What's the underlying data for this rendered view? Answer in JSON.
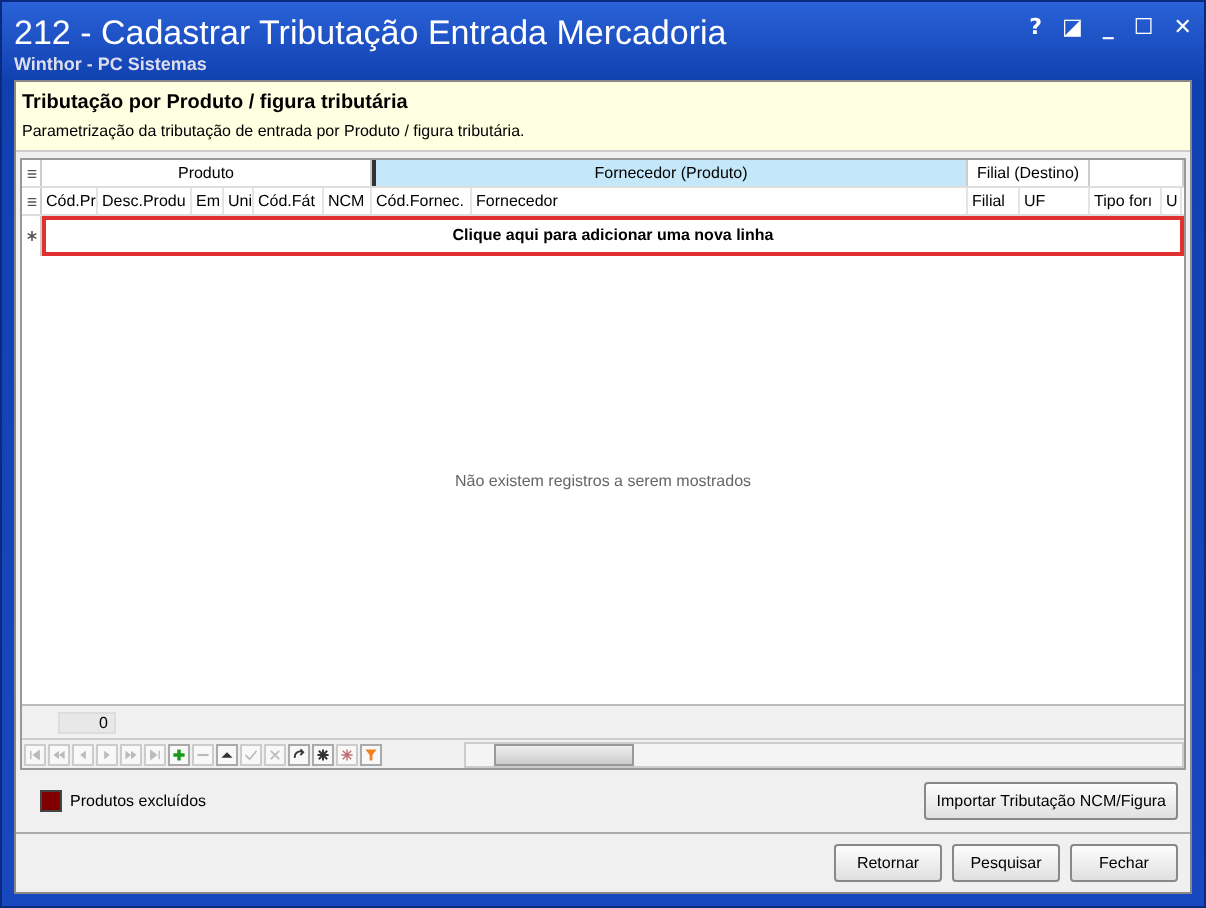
{
  "window": {
    "title": "212 - Cadastrar Tributação Entrada Mercadoria",
    "subtitle": "Winthor - PC Sistemas",
    "controls": [
      "?",
      "◪",
      "_",
      "☐",
      "✕"
    ]
  },
  "header": {
    "title": "Tributação por Produto / figura tributária",
    "description": "Parametrização da tributação de entrada por Produto / figura tributária."
  },
  "grid": {
    "groups": [
      {
        "label": "Produto",
        "selected": false
      },
      {
        "label": "Fornecedor (Produto)",
        "selected": true
      },
      {
        "label": "Filial (Destino)",
        "selected": false
      }
    ],
    "columns": [
      "Cód.Pr",
      "Desc.Produ",
      "Em",
      "Uni",
      "Cód.Fát",
      "NCM",
      "Cód.Fornec.",
      "Fornecedor",
      "Filial",
      "UF",
      "Tipo forı",
      "U"
    ],
    "new_row": "Clique aqui para adicionar uma nova linha",
    "empty_message": "Não existem registros a serem mostrados",
    "row_count": "0"
  },
  "nav_buttons": [
    {
      "kind": "first",
      "disabled": true
    },
    {
      "kind": "prev-page",
      "disabled": true
    },
    {
      "kind": "prev",
      "disabled": true
    },
    {
      "kind": "next",
      "disabled": true
    },
    {
      "kind": "next-page",
      "disabled": true
    },
    {
      "kind": "last",
      "disabled": true
    },
    {
      "kind": "add",
      "disabled": false
    },
    {
      "kind": "remove",
      "disabled": true
    },
    {
      "kind": "edit",
      "disabled": false
    },
    {
      "kind": "post",
      "disabled": true
    },
    {
      "kind": "cancel",
      "disabled": true
    },
    {
      "kind": "refresh",
      "disabled": false
    },
    {
      "kind": "asterisk",
      "disabled": false
    },
    {
      "kind": "clear",
      "disabled": true
    },
    {
      "kind": "filter",
      "disabled": false
    }
  ],
  "legend": [
    {
      "label": "Produtos excluídos",
      "color": "#800000"
    }
  ],
  "import_button": "Importar Tributação NCM/Figura",
  "buttons": [
    "Retornar",
    "Pesquisar",
    "Fechar"
  ]
}
